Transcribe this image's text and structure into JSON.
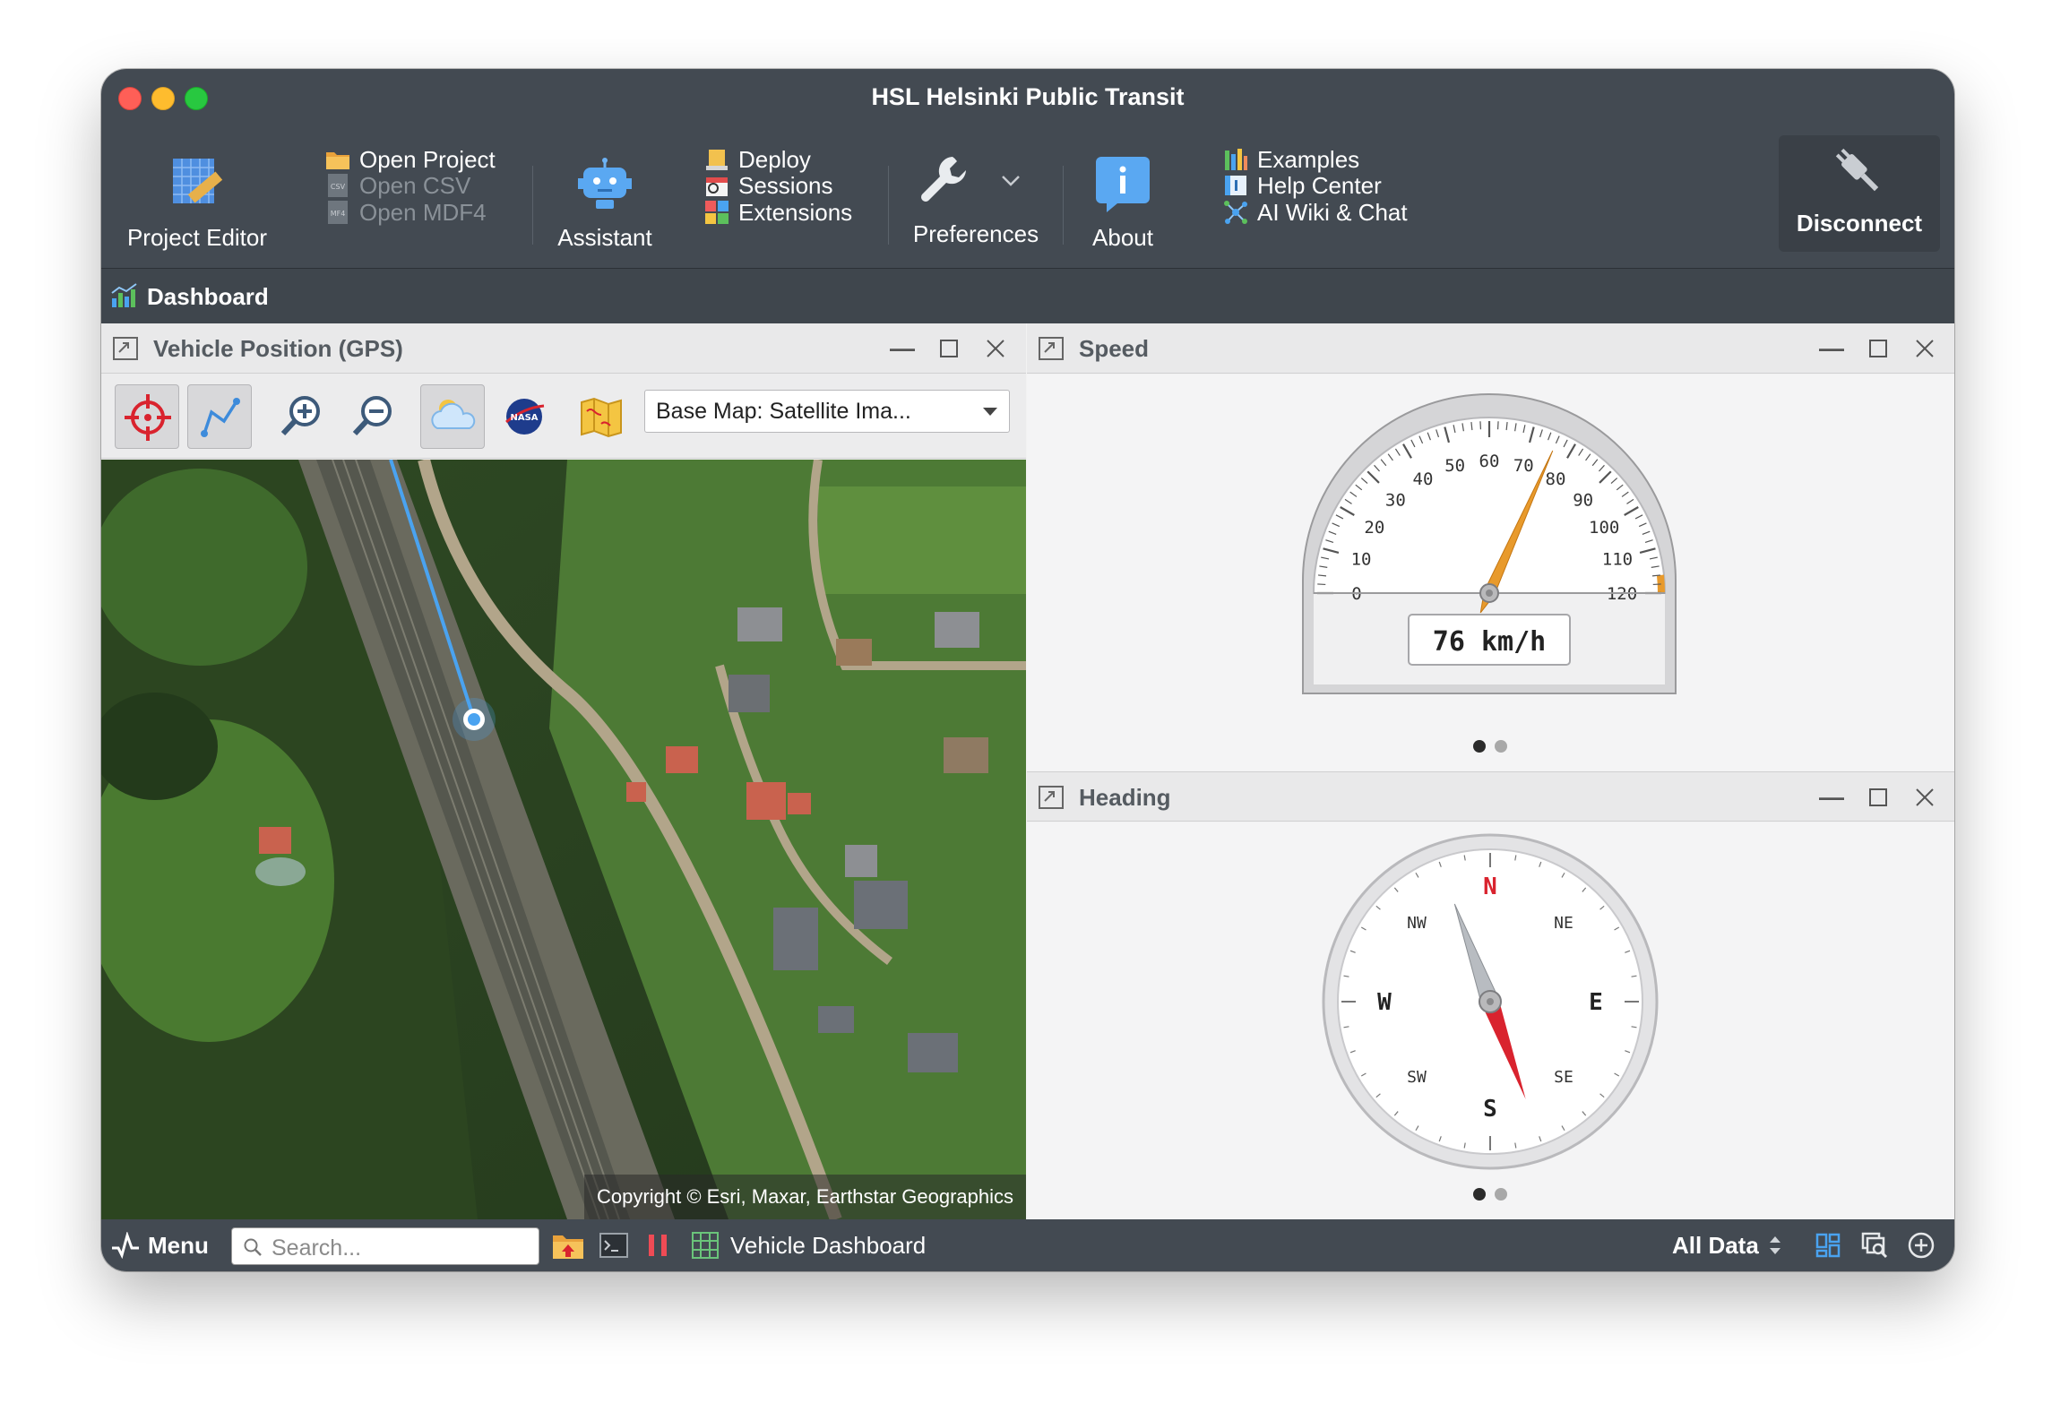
{
  "window": {
    "title": "HSL Helsinki Public Transit"
  },
  "toolbar": {
    "project_editor": "Project Editor",
    "open_project": "Open Project",
    "open_csv": "Open CSV",
    "open_mdf4": "Open MDF4",
    "assistant": "Assistant",
    "deploy": "Deploy",
    "sessions": "Sessions",
    "extensions": "Extensions",
    "preferences": "Preferences",
    "about": "About",
    "examples": "Examples",
    "help_center": "Help Center",
    "ai_wiki": "AI Wiki & Chat",
    "disconnect": "Disconnect"
  },
  "dashboard": {
    "title": "Dashboard"
  },
  "gps": {
    "title": "Vehicle Position (GPS)",
    "base_map": "Base Map: Satellite Ima...",
    "copyright": "Copyright © Esri, Maxar, Earthstar Geographics"
  },
  "speed": {
    "title": "Speed",
    "value": 76,
    "unit": "km/h",
    "readout": "76 km/h",
    "min": 0,
    "max": 120,
    "ticks": [
      "0",
      "10",
      "20",
      "30",
      "40",
      "50",
      "60",
      "70",
      "80",
      "90",
      "100",
      "110",
      "120"
    ]
  },
  "heading": {
    "title": "Heading",
    "degrees": 160,
    "labels": {
      "n": "N",
      "ne": "NE",
      "e": "E",
      "se": "SE",
      "s": "S",
      "sw": "SW",
      "w": "W",
      "nw": "NW"
    }
  },
  "statusbar": {
    "menu": "Menu",
    "search_placeholder": "Search...",
    "workspace": "Vehicle Dashboard",
    "filter": "All Data"
  },
  "colors": {
    "chrome": "#434a52",
    "accent": "#4aa3f0",
    "needle_speed": "#e89a2c",
    "needle_north": "#d9232e"
  },
  "icons": {
    "project_editor": "ruler-grid-icon",
    "assistant": "robot-icon",
    "preferences": "wrench-icon",
    "about": "info-icon",
    "disconnect": "plug-icon"
  }
}
